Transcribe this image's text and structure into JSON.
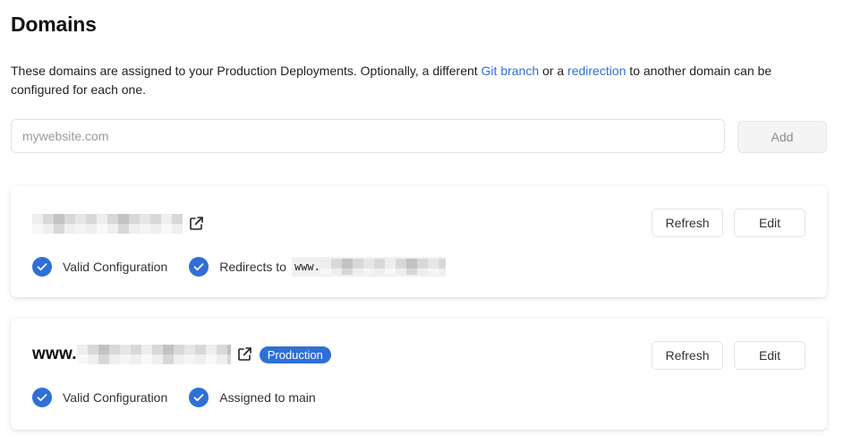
{
  "page": {
    "title": "Domains",
    "description_start": "These domains are assigned to your Production Deployments. Optionally, a different ",
    "link_git_branch": "Git branch",
    "description_middle": " or a ",
    "link_redirection": "redirection",
    "description_end": " to another domain can be configured for each one."
  },
  "add_domain": {
    "placeholder": "mywebsite.com",
    "button_label": "Add"
  },
  "domains": [
    {
      "name_prefix": "",
      "badge": "",
      "statuses": [
        {
          "label": "Valid Configuration"
        },
        {
          "label": "Redirects to",
          "target_prefix": "www."
        }
      ],
      "refresh_label": "Refresh",
      "edit_label": "Edit"
    },
    {
      "name_prefix": "www.",
      "badge": "Production",
      "statuses": [
        {
          "label": "Valid Configuration"
        },
        {
          "label": "Assigned to main"
        }
      ],
      "refresh_label": "Refresh",
      "edit_label": "Edit"
    }
  ],
  "colors": {
    "accent": "#2f6fd6",
    "check": "#2f6fd6"
  },
  "icons": {
    "external": "external-link-icon",
    "check": "check-circle-icon"
  }
}
